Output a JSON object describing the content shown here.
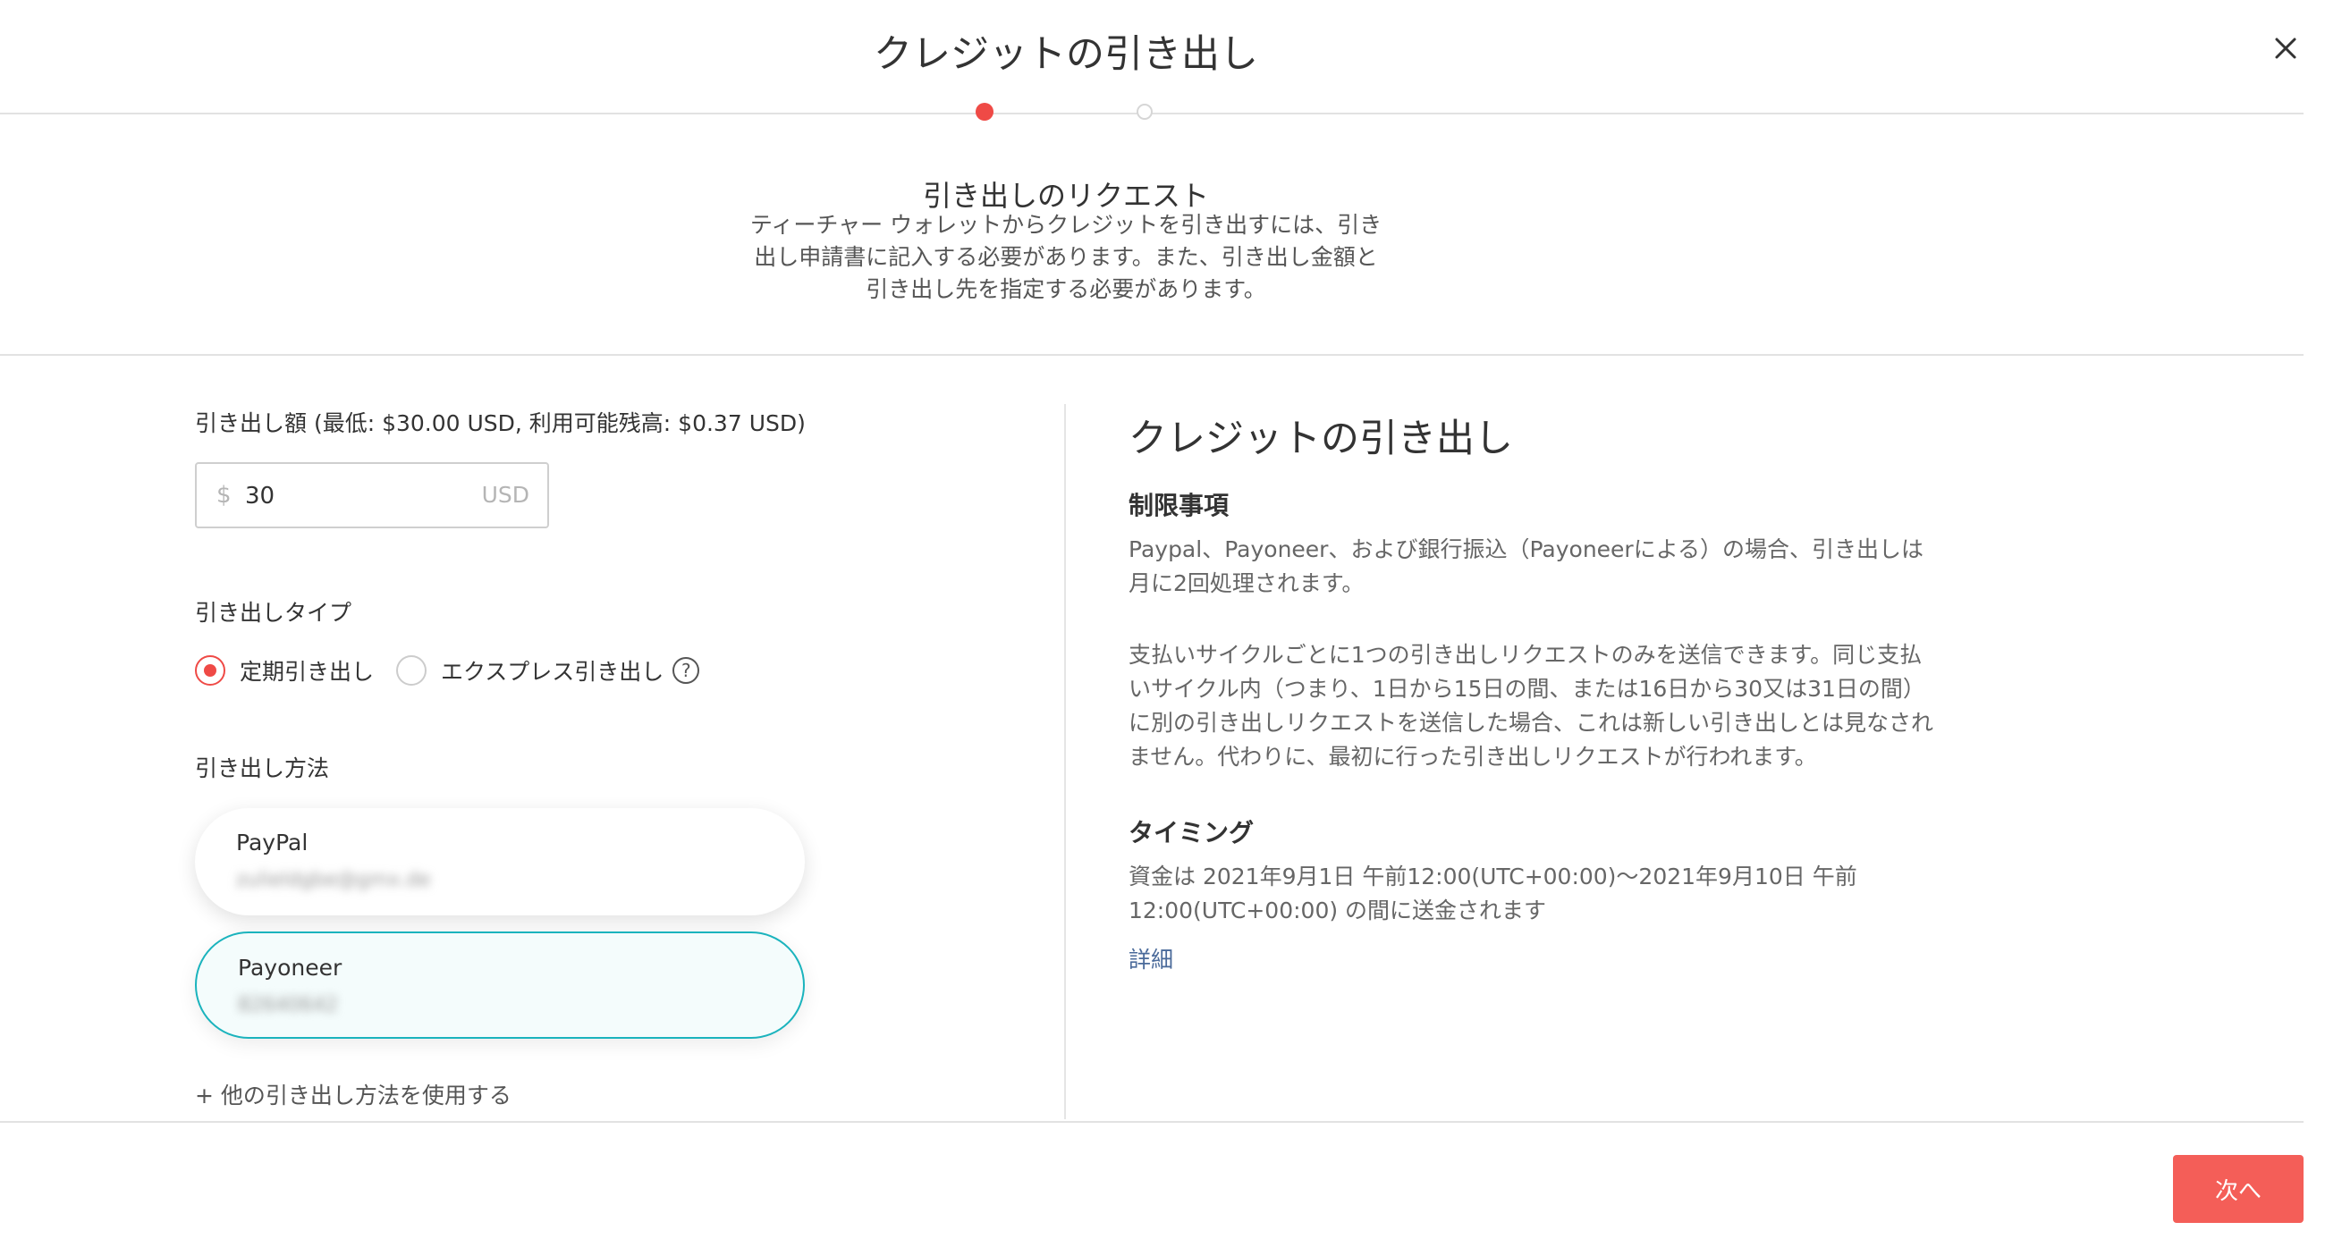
{
  "dialog": {
    "title": "クレジットの引き出し",
    "steps_total": 2,
    "step_current": 1
  },
  "request": {
    "title": "引き出しのリクエスト",
    "description": "ティーチャー ウォレットからクレジットを引き出すには、引き出し申請書に記入する必要があります。また、引き出し金額と引き出し先を指定する必要があります。"
  },
  "form": {
    "amount_label": "引き出し額 (最低: $30.00 USD, 利用可能残高: $0.37 USD)",
    "amount_prefix": "$",
    "amount_value": "30",
    "amount_unit": "USD",
    "type_label": "引き出しタイプ",
    "type_options": [
      {
        "label": "定期引き出し",
        "selected": true
      },
      {
        "label": "エクスプレス引き出し",
        "selected": false
      }
    ],
    "help_glyph": "?",
    "method_label": "引き出し方法",
    "methods": [
      {
        "name": "PayPal",
        "account": "zulieldgbe@gmx.de",
        "selected": false
      },
      {
        "name": "Payoneer",
        "account": "82640642",
        "selected": true
      }
    ],
    "other_method_link": "+ 他の引き出し方法を使用する"
  },
  "info": {
    "title": "クレジットの引き出し",
    "restrictions_heading": "制限事項",
    "restrictions_p1": "Paypal、Payoneer、および銀行振込（Payoneerによる）の場合、引き出しは月に2回処理されます。",
    "restrictions_p2": "支払いサイクルごとに1つの引き出しリクエストのみを送信できます。同じ支払いサイクル内（つまり、1日から15日の間、または16日から30又は31日の間）に別の引き出しリクエストを送信した場合、これは新しい引き出しとは見なされません。代わりに、最初に行った引き出しリクエストが行われます。",
    "timing_heading": "タイミング",
    "timing_text": "資金は 2021年9月1日 午前12:00(UTC+00:00)～2021年9月10日 午前12:00(UTC+00:00) の間に送金されます",
    "more_link": "詳細"
  },
  "footer": {
    "next_label": "次へ"
  },
  "colors": {
    "accent": "#ef4a46",
    "selected_border": "#1ab3bd",
    "next_button": "#f45e58",
    "link": "#4a6a9a"
  },
  "icons": {
    "close": "close-icon",
    "help": "help-icon",
    "step_active": "step-dot-active",
    "step_inactive": "step-dot-inactive"
  }
}
